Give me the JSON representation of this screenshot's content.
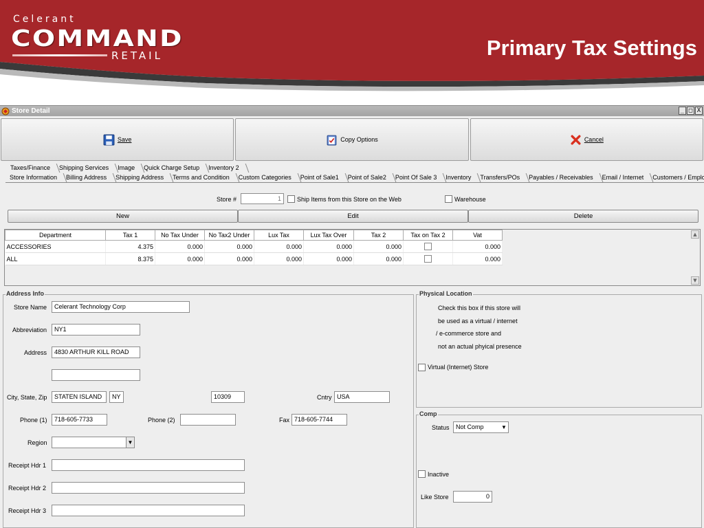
{
  "slide": {
    "logo_top": "Celerant",
    "logo_main": "COMMAND",
    "logo_bottom": "RETAIL",
    "title": "Primary Tax Settings",
    "brand_color": "#a6262a"
  },
  "window": {
    "title": "Store Detail",
    "controls": [
      "_",
      "□",
      "X"
    ]
  },
  "toolbar": {
    "save_label": "Save",
    "copy_label": "Copy Options",
    "cancel_label": "Cancel"
  },
  "tabs_row1": [
    "Taxes/Finance",
    "Shipping Services",
    "Image",
    "Quick Charge Setup",
    "Inventory 2"
  ],
  "tabs_row2": [
    "Store Information",
    "Billing Address",
    "Shipping Address",
    "Terms and Condition",
    "Custom Categories",
    "Point of Sale1",
    "Point of Sale2",
    "Point Of Sale 3",
    "Inventory",
    "Transfers/POs",
    "Payables / Receivables",
    "Email / Internet",
    "Customers / Employees"
  ],
  "store": {
    "store_num_label": "Store #",
    "store_num_value": "1",
    "ship_web_label": "Ship Items from this Store on the Web",
    "warehouse_label": "Warehouse"
  },
  "actions": {
    "new_label": "New",
    "edit_label": "Edit",
    "delete_label": "Delete"
  },
  "tax_table": {
    "headers": [
      "Department",
      "Tax 1",
      "No Tax Under",
      "No Tax2 Under",
      "Lux Tax",
      "Lux Tax Over",
      "Tax 2",
      "Tax on Tax 2",
      "Vat"
    ],
    "rows": [
      [
        "ACCESSORIES",
        "4.375",
        "0.000",
        "0.000",
        "0.000",
        "0.000",
        "0.000",
        "",
        "0.000"
      ],
      [
        "ALL",
        "8.375",
        "0.000",
        "0.000",
        "0.000",
        "0.000",
        "0.000",
        "",
        "0.000"
      ]
    ]
  },
  "address": {
    "group_title": "Address Info",
    "store_name_label": "Store Name",
    "store_name_value": "Celerant Technology Corp",
    "abbrev_label": "Abbreviation",
    "abbrev_value": "NY1",
    "address_label": "Address",
    "address_value": "4830 ARTHUR KILL ROAD",
    "address2_value": "",
    "city_label": "City, State, Zip",
    "city_value": "STATEN ISLAND",
    "state_value": "NY",
    "zip_value": "10309",
    "country_label": "Cntry",
    "country_value": "USA",
    "phone1_label": "Phone (1)",
    "phone1_value": "718-605-7733",
    "phone2_label": "Phone (2)",
    "phone2_value": "",
    "fax_label": "Fax",
    "fax_value": "718-605-7744",
    "region_label": "Region",
    "region_value": "",
    "receipt1_label": "Receipt Hdr 1",
    "receipt2_label": "Receipt Hdr 2",
    "receipt3_label": "Receipt Hdr 3"
  },
  "physical": {
    "group_title": "Physical Location",
    "desc_line1": "Check this box if this store will",
    "desc_line2": "be used as a virtual / internet",
    "desc_line3": "/ e-commerce store and",
    "desc_line4": "not an actual phyical presence",
    "virtual_label": "Virtual (Internet) Store"
  },
  "comp": {
    "group_title": "Comp",
    "status_label": "Status",
    "status_value": "Not Comp",
    "inactive_label": "Inactive",
    "like_store_label": "Like Store",
    "like_store_value": "0"
  }
}
